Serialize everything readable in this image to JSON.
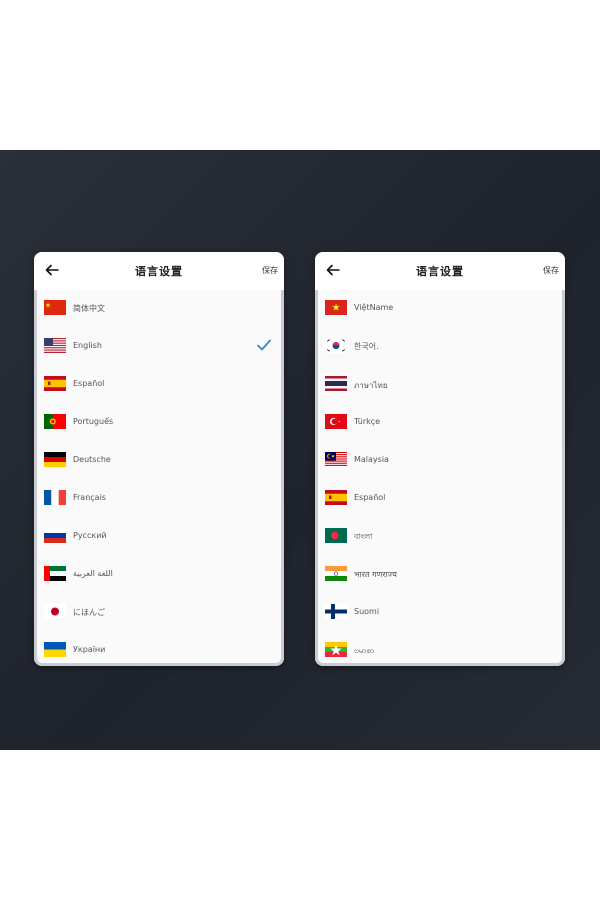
{
  "left": {
    "title": "语言设置",
    "save_label": "保存",
    "items": [
      {
        "label": "简体中文",
        "flag": "china-flag"
      },
      {
        "label": "English",
        "flag": "usa-flag",
        "selected": true
      },
      {
        "label": "Español",
        "flag": "spain-flag"
      },
      {
        "label": "Portuguếs",
        "flag": "portugal-flag"
      },
      {
        "label": "Deutsche",
        "flag": "germany-flag"
      },
      {
        "label": "Français",
        "flag": "france-flag"
      },
      {
        "label": "Русский",
        "flag": "russia-flag"
      },
      {
        "label": "اللغة العربية",
        "flag": "uae-flag"
      },
      {
        "label": "にほんご",
        "flag": "japan-flag"
      },
      {
        "label": "України",
        "flag": "ukraine-flag"
      }
    ]
  },
  "right": {
    "title": "语言设置",
    "save_label": "保存",
    "items": [
      {
        "label": "ViệtName",
        "flag": "vietnam-flag"
      },
      {
        "label": "한국어.",
        "flag": "korea-flag"
      },
      {
        "label": "ภาษาไทย",
        "flag": "thailand-flag"
      },
      {
        "label": "Türkçe",
        "flag": "turkey-flag"
      },
      {
        "label": "Malaysia",
        "flag": "malaysia-flag"
      },
      {
        "label": "Español",
        "flag": "spain-flag"
      },
      {
        "label": "বাংলা",
        "flag": "bangladesh-flag"
      },
      {
        "label": "भारत गणराज्य",
        "flag": "india-flag"
      },
      {
        "label": "Suomi",
        "flag": "finland-flag"
      },
      {
        "label": "ဗမာစာ",
        "flag": "myanmar-flag"
      }
    ]
  },
  "colors": {
    "accent": "#3d86d6",
    "stage": "#242932",
    "panel": "#fafafa"
  }
}
